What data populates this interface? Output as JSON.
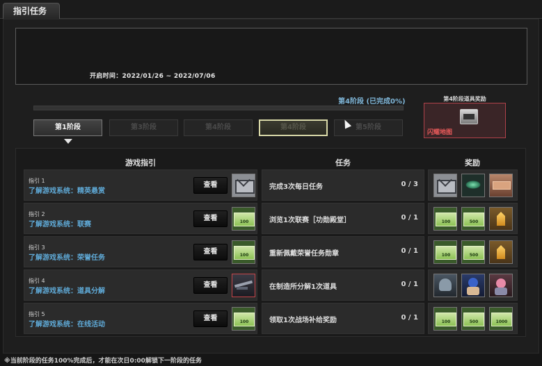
{
  "window": {
    "tab_title": "指引任务"
  },
  "info": {
    "open_time": "开启时间：2022/01/26 ~ 2022/07/06"
  },
  "progress": {
    "label": "第4阶段 (已完成0%)",
    "percent": 0
  },
  "stages": [
    {
      "label": "第1阶段",
      "state": "active"
    },
    {
      "label": "第3阶段",
      "state": "locked"
    },
    {
      "label": "第4阶段",
      "state": "locked"
    },
    {
      "label": "第4阶段",
      "state": "current"
    },
    {
      "label": "第5阶段",
      "state": "locked"
    }
  ],
  "stage_reward": {
    "title": "第4阶段道具奖励",
    "label": "闪耀地图"
  },
  "columns": {
    "guide": "游戏指引",
    "task": "任务",
    "reward": "奖励"
  },
  "view_label": "查看",
  "ticket_text": {
    "a": "收获积分\n100",
    "b": "收获积分\n500",
    "c": "收获积分\n1000"
  },
  "rows": [
    {
      "num": "指引 1",
      "title": "了解游戏系统：精英悬赏",
      "task": "完成3次每日任务",
      "count": "0 / 3"
    },
    {
      "num": "指引 2",
      "title": "了解游戏系统：联赛",
      "task": "浏览1次联赛［功勋殿堂］",
      "count": "0 / 1"
    },
    {
      "num": "指引 3",
      "title": "了解游戏系统：荣誉任务",
      "task": "重新佩戴荣誉任务勋章",
      "count": "0 / 1"
    },
    {
      "num": "指引 4",
      "title": "了解游戏系统：道具分解",
      "task": "在制造所分解1次道具",
      "count": "0 / 1"
    },
    {
      "num": "指引 5",
      "title": "了解游戏系统：在线活动",
      "task": "领取1次战场补给奖励",
      "count": "0 / 1"
    }
  ],
  "footnote": "※当前阶段的任务100%完成后，才能在次日0:00解锁下一阶段的任务",
  "colors": {
    "accent_blue": "#5fa9d6",
    "reward_red": "#b0424a",
    "ticket_green": "#8cc255"
  }
}
